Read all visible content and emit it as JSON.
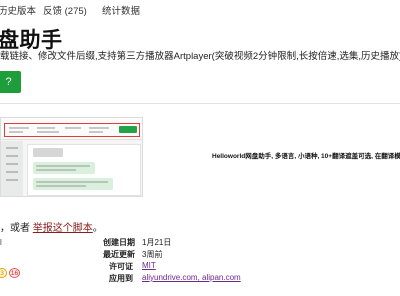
{
  "tabs": {
    "history": "历史版本",
    "feedback": "反馈 (275)",
    "stats": "统计数据"
  },
  "script": {
    "title": "盘助手",
    "description": "载链接、修改文件后缀,支持第三方播放器Artplayer(突破视频2分钟限制,长按倍速,选集,历史播放)",
    "install_label": "?"
  },
  "screenshot": {
    "caption": "Helloworld网盘助手, 多语言, 小语种, 10+翻译遮盖可选, 在翻译模板"
  },
  "report": {
    "prefix": "，或者 ",
    "link": "举报这个脚本",
    "suffix": "。"
  },
  "author_initial": "l",
  "meta": {
    "created_label": "创建日期",
    "created_value": "1月21日",
    "updated_label": "最近更新",
    "updated_value": "3周前",
    "license_label": "许可证",
    "license_value": "MIT",
    "applies_label": "应用到",
    "applies_value": "aliyundrive.com, alipan.com"
  },
  "ratings": {
    "neutral": "3",
    "bad": "16"
  },
  "colors": {
    "install_green": "#1e9e3a",
    "report_link": "#8a1c1c",
    "meta_link": "#6b2a8c",
    "rating_neutral": "#e0a800",
    "rating_bad": "#e25a5a"
  }
}
